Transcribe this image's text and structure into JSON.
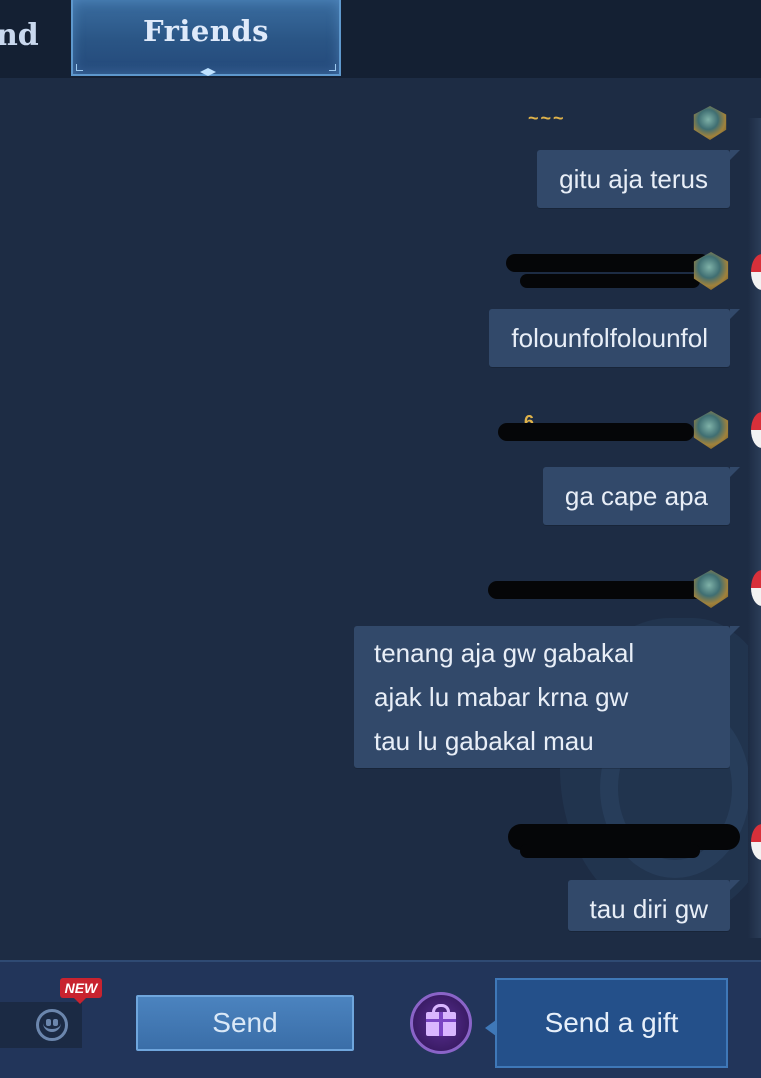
{
  "tabs": [
    {
      "label": "nd"
    },
    {
      "label": "Friends"
    }
  ],
  "messages": [
    {
      "text": "gitu aja terus"
    },
    {
      "text": "folounfolfolounfol"
    },
    {
      "text": "ga cape apa"
    },
    {
      "lines": [
        "tenang aja gw gabakal",
        "ajak lu mabar krna gw",
        "tau lu gabakal mau"
      ]
    },
    {
      "text": "tau diri gw"
    }
  ],
  "bottom": {
    "new_badge": "NEW",
    "send_label": "Send",
    "gift_label": "Send a gift"
  },
  "colors": {
    "background": "#1d2c44",
    "bubble": "#32496a",
    "tab_active": "#2a5585",
    "accent_red": "#c8232f"
  }
}
